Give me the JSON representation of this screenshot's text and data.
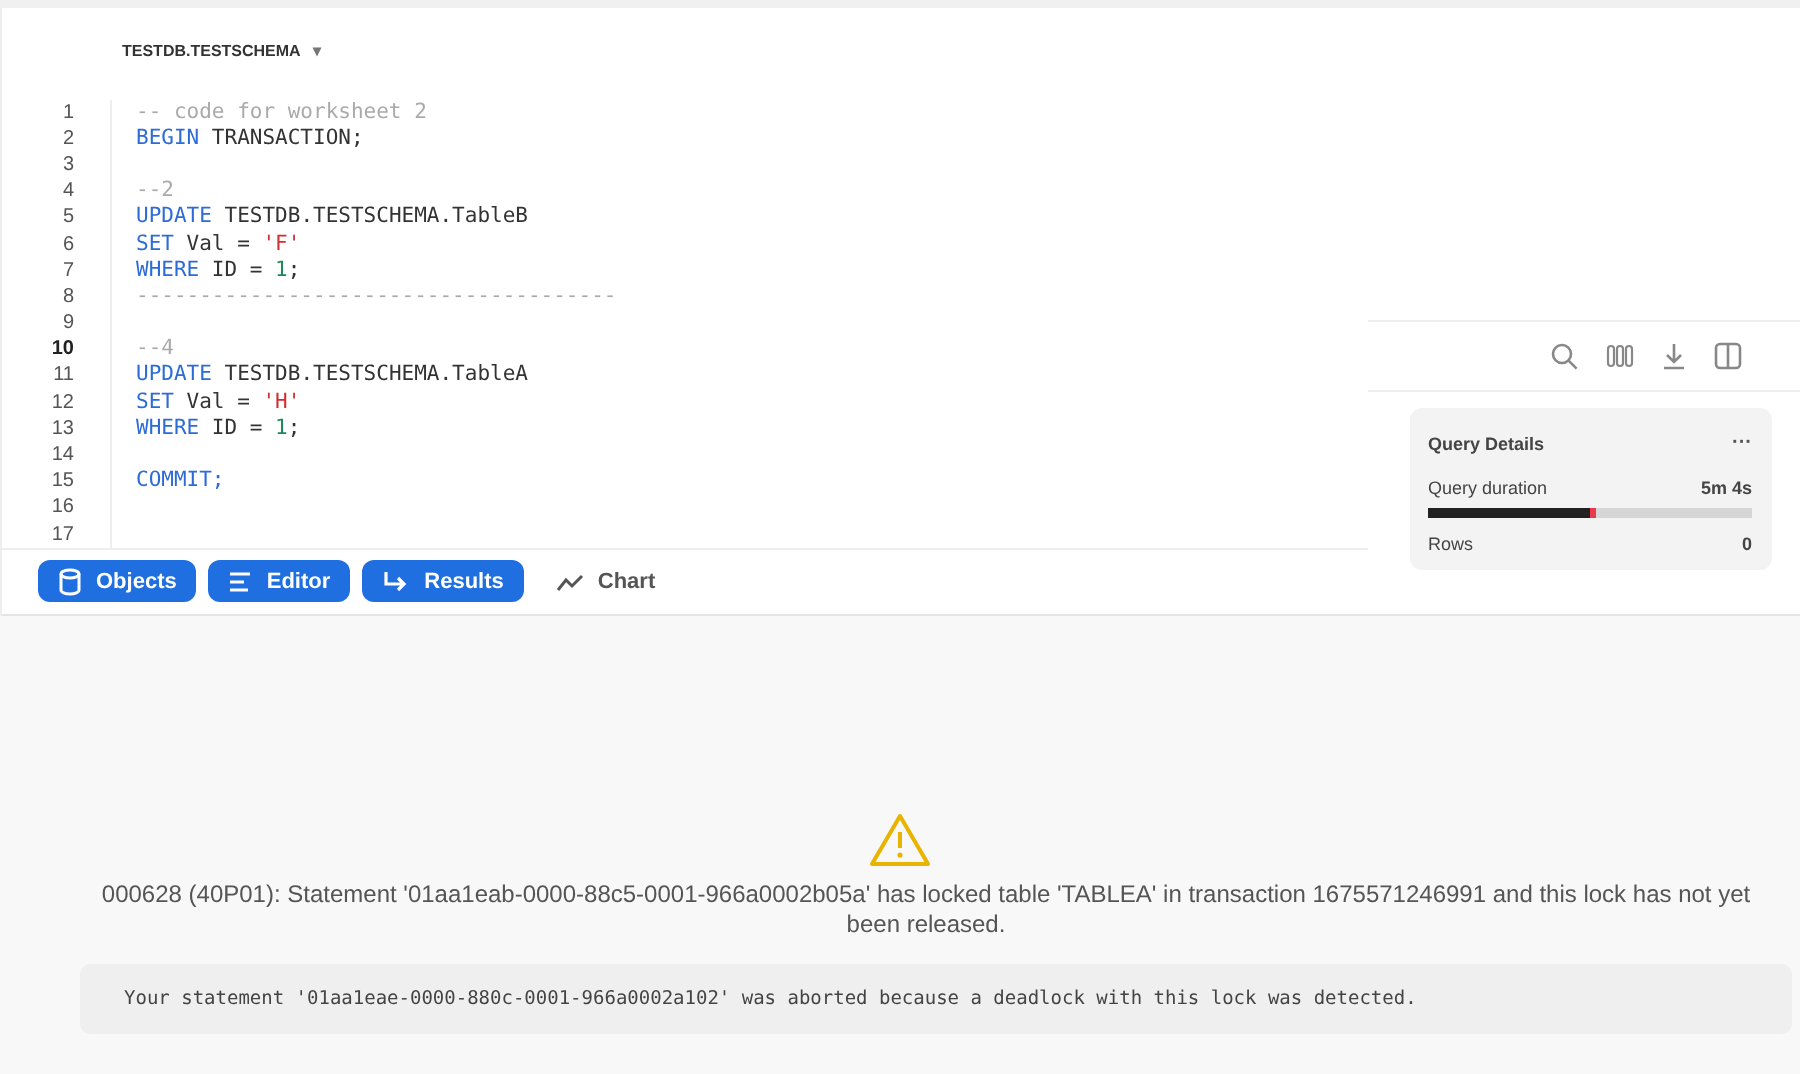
{
  "schema_selector": {
    "label": "TESTDB.TESTSCHEMA",
    "caret": "▾"
  },
  "code_lines": [
    {
      "number": "1",
      "current": false,
      "tokens": [
        {
          "kind": "comment",
          "text": "-- code for worksheet 2"
        }
      ]
    },
    {
      "number": "2",
      "current": false,
      "tokens": [
        {
          "kind": "keyword",
          "text": "BEGIN"
        },
        {
          "kind": "plain",
          "text": " TRANSACTION;"
        }
      ]
    },
    {
      "number": "3",
      "current": false
    },
    {
      "number": "4",
      "current": false,
      "tokens": [
        {
          "kind": "comment",
          "text": "--2"
        }
      ]
    },
    {
      "number": "5",
      "current": false,
      "tokens": [
        {
          "kind": "keyword",
          "text": "UPDATE"
        },
        {
          "kind": "plain",
          "text": " TESTDB.TESTSCHEMA.TableB"
        }
      ]
    },
    {
      "number": "6",
      "current": false,
      "tokens": [
        {
          "kind": "keyword",
          "text": "SET"
        },
        {
          "kind": "plain",
          "text": " Val = "
        },
        {
          "kind": "string",
          "text": "'F'"
        }
      ]
    },
    {
      "number": "7",
      "current": false,
      "tokens": [
        {
          "kind": "keyword",
          "text": "WHERE"
        },
        {
          "kind": "plain",
          "text": " ID = "
        },
        {
          "kind": "number",
          "text": "1"
        },
        {
          "kind": "plain",
          "text": ";"
        }
      ]
    },
    {
      "number": "8",
      "current": false,
      "tokens": [
        {
          "kind": "comment",
          "text": "--------------------------------------"
        }
      ]
    },
    {
      "number": "9",
      "current": false
    },
    {
      "number": "10",
      "current": true,
      "tokens": [
        {
          "kind": "comment",
          "text": "--4"
        }
      ]
    },
    {
      "number": "11",
      "current": false,
      "tokens": [
        {
          "kind": "keyword",
          "text": "UPDATE"
        },
        {
          "kind": "plain",
          "text": " TESTDB.TESTSCHEMA.TableA"
        }
      ]
    },
    {
      "number": "12",
      "current": false,
      "tokens": [
        {
          "kind": "keyword",
          "text": "SET"
        },
        {
          "kind": "plain",
          "text": " Val = "
        },
        {
          "kind": "string",
          "text": "'H'"
        }
      ]
    },
    {
      "number": "13",
      "current": false,
      "tokens": [
        {
          "kind": "keyword",
          "text": "WHERE"
        },
        {
          "kind": "plain",
          "text": " ID = "
        },
        {
          "kind": "number",
          "text": "1"
        },
        {
          "kind": "plain",
          "text": ";"
        }
      ]
    },
    {
      "number": "14",
      "current": false
    },
    {
      "number": "15",
      "current": false,
      "tokens": [
        {
          "kind": "keyword",
          "text": "COMMIT;"
        }
      ]
    },
    {
      "number": "16",
      "current": false
    },
    {
      "number": "17",
      "current": false
    }
  ],
  "pane_buttons": [
    {
      "label": "Objects",
      "on": true
    },
    {
      "label": "Editor",
      "on": true
    },
    {
      "label": "Results",
      "on": true
    },
    {
      "label": "Chart",
      "on": false
    }
  ],
  "query_details": {
    "title": "Query Details",
    "menu": "···",
    "duration_label": "Query duration",
    "duration": "5m 4s",
    "level": 0.52,
    "rows_label": "Rows",
    "rows": "0"
  },
  "error": {
    "message": "000628 (40P01): Statement '01aa1eab-0000-88c5-0001-966a0002b05a' has locked table 'TABLEA' in transaction 1675571246991 and this lock has not yet been released.",
    "detail": "Your statement '01aa1eae-0000-880c-0001-966a0002a102' was aborted because a deadlock with this lock was detected."
  }
}
